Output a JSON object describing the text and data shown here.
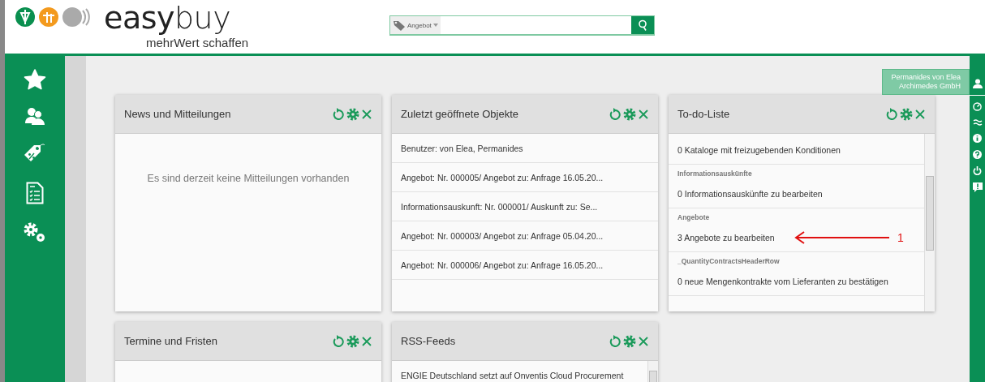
{
  "header": {
    "logo": "**easy**buy",
    "tagline": "mehrWert schaffen"
  },
  "search": {
    "category": "Angebot"
  },
  "user_badge": [
    "Permanides von Elea",
    "Archimedes GmbH"
  ],
  "widgets": [
    {
      "kind": "message",
      "title": "News und Mitteilungen",
      "message": "Es sind derzeit keine Mitteilungen vorhanden"
    },
    {
      "kind": "list",
      "title": "Zuletzt geöffnete Objekte",
      "items": [
        "Benutzer: von Elea, Permanides",
        "Angebot: Nr. 000005/ Angebot zu: Anfrage 16.05.20...",
        "Informationsauskunft: Nr. 000001/ Auskunft zu: Se...",
        "Angebot: Nr. 000003/ Angebot zu: Anfrage 05.04.20...",
        "Angebot: Nr. 000006/ Angebot zu: Anfrage 16.05.20..."
      ]
    },
    {
      "kind": "todo",
      "title": "To-do-Liste",
      "items": [
        {
          "text": "0 Kataloge mit freizugebenden Konditionen"
        },
        {
          "heading": "Informationsauskünfte",
          "text": "0 Informationsauskünfte zu bearbeiten"
        },
        {
          "heading": "Angebote",
          "text": "3 Angebote zu bearbeiten",
          "annotation": "1"
        },
        {
          "heading": "_QuantityContractsHeaderRow",
          "text": "0 neue Mengenkontrakte vom Lieferanten zu bestätigen"
        }
      ]
    },
    {
      "kind": "empty",
      "title": "Termine und Fristen"
    },
    {
      "kind": "feed",
      "title": "RSS-Feeds",
      "items": [
        "ENGIE Deutschland setzt auf Onventis Cloud Procurement"
      ]
    }
  ]
}
